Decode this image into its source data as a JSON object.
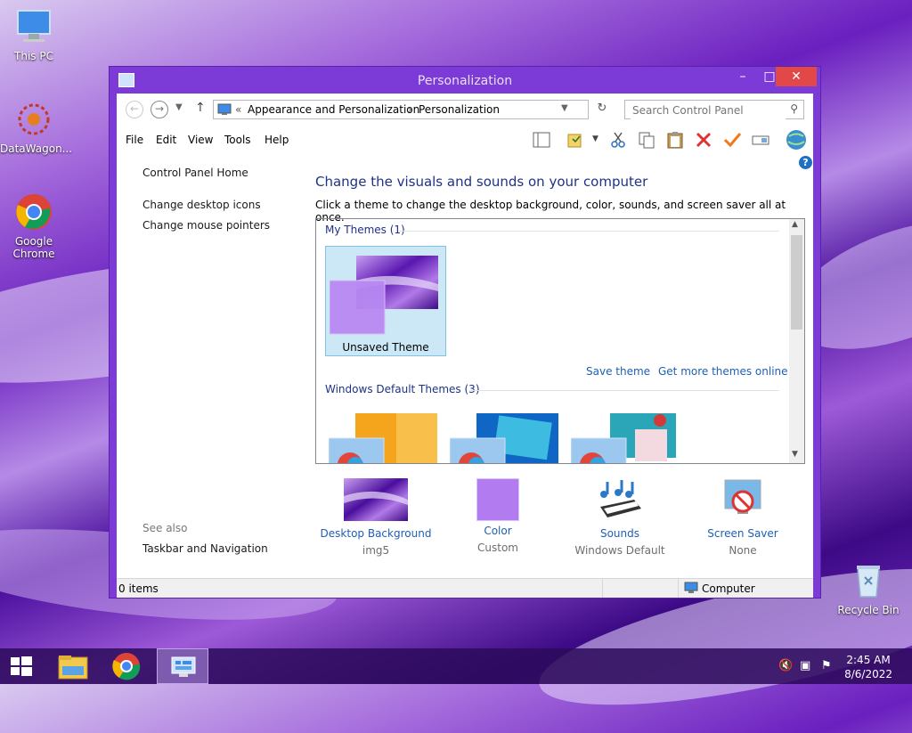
{
  "desktop": {
    "icons": [
      {
        "label": "This PC"
      },
      {
        "label": "DataWagon..."
      },
      {
        "label": "Google Chrome"
      },
      {
        "label": "Recycle Bin"
      }
    ]
  },
  "window": {
    "title": "Personalization",
    "address": {
      "prefix": "«",
      "crumbs": [
        "Appearance and Personalization",
        "Personalization"
      ],
      "separator": "›"
    },
    "search": {
      "placeholder": "Search Control Panel"
    },
    "menu": [
      "File",
      "Edit",
      "View",
      "Tools",
      "Help"
    ]
  },
  "left_pane": {
    "home": "Control Panel Home",
    "links": [
      "Change desktop icons",
      "Change mouse pointers"
    ],
    "see_also": "See also",
    "see_also_links": [
      "Taskbar and Navigation"
    ]
  },
  "main": {
    "heading": "Change the visuals and sounds on your computer",
    "description": "Click a theme to change the desktop background, color, sounds, and screen saver all at once.",
    "my_themes": {
      "label": "My Themes (1)",
      "items": [
        {
          "name": "Unsaved Theme"
        }
      ]
    },
    "actions": {
      "save": "Save theme",
      "more": "Get more themes online"
    },
    "default_themes": {
      "label": "Windows Default Themes (3)"
    }
  },
  "bottom": [
    {
      "label": "Desktop Background",
      "value": "img5"
    },
    {
      "label": "Color",
      "value": "Custom"
    },
    {
      "label": "Sounds",
      "value": "Windows Default"
    },
    {
      "label": "Screen Saver",
      "value": "None"
    }
  ],
  "status": {
    "items": "0 items",
    "location": "Computer"
  },
  "taskbar": {
    "time": "2:45 AM",
    "date": "8/6/2022"
  },
  "colors": {
    "accent": "#7c3ad6",
    "close": "#e24848",
    "link": "#1f5fb4",
    "heading": "#1e3287"
  }
}
